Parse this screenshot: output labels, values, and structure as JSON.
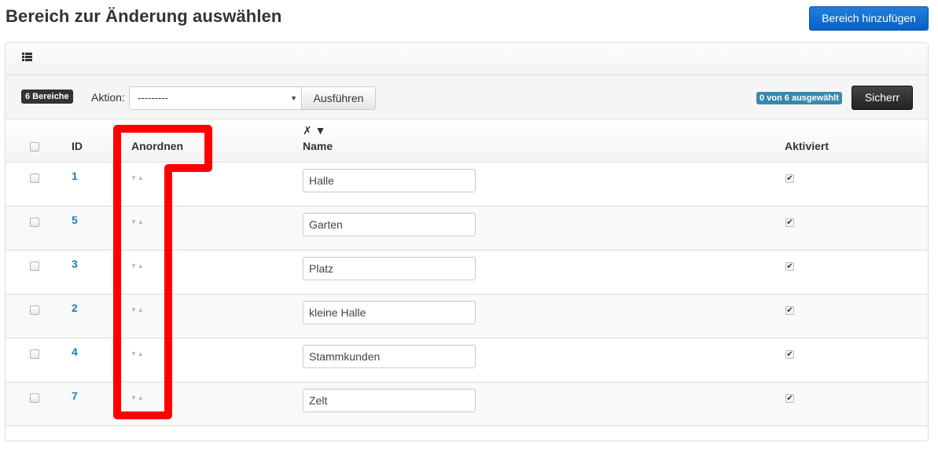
{
  "header": {
    "title": "Bereich zur Änderung auswählen",
    "add_button": "Bereich hinzufügen"
  },
  "toolbar": {
    "count_badge": "6 Bereiche",
    "action_label": "Aktion:",
    "action_select_value": "---------",
    "run_button": "Ausführen",
    "selected_badge": "0 von 6 ausgewählt",
    "save_button": "Sicherr"
  },
  "table": {
    "columns": {
      "id": "ID",
      "order": "Anordnen",
      "name_toggle": "✗ ▼",
      "name": "Name",
      "active": "Aktiviert"
    },
    "rows": [
      {
        "id": "1",
        "name": "Halle",
        "active": true
      },
      {
        "id": "5",
        "name": "Garten",
        "active": true
      },
      {
        "id": "3",
        "name": "Platz",
        "active": true
      },
      {
        "id": "2",
        "name": "kleine Halle",
        "active": true
      },
      {
        "id": "4",
        "name": "Stammkunden",
        "active": true
      },
      {
        "id": "7",
        "name": "Zelt",
        "active": true
      }
    ]
  },
  "colors": {
    "primary": "#0a66cc",
    "save": "#222222",
    "link": "#1a7fbf",
    "selected_badge": "#3a87ad",
    "highlight": "#ff0000"
  },
  "icons": {
    "list": "list-icon",
    "sort": "sort-arrows-icon"
  }
}
